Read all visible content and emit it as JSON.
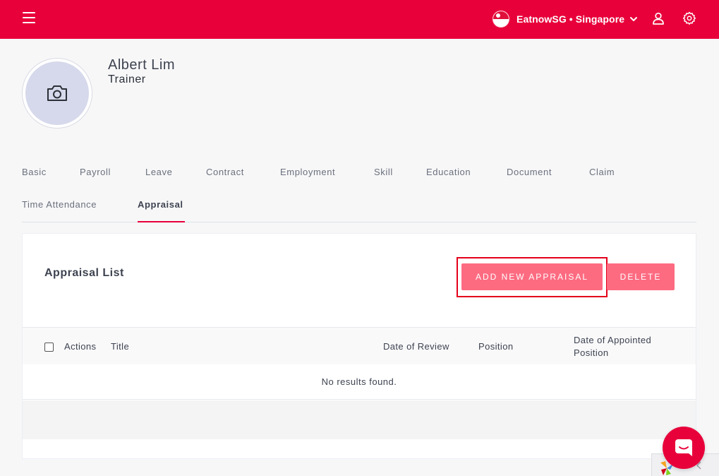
{
  "topbar": {
    "company_label": "EatnowSG • Singapore",
    "brand_color": "#e8003a",
    "icons": [
      "menu-icon",
      "singapore-flag-icon",
      "chevron-down-icon",
      "user-icon",
      "settings-gear-icon"
    ]
  },
  "profile": {
    "name": "Albert Lim",
    "role": "Trainer",
    "avatar_icon": "camera-icon"
  },
  "tabs": [
    {
      "label": "Basic"
    },
    {
      "label": "Payroll"
    },
    {
      "label": "Leave"
    },
    {
      "label": "Contract"
    },
    {
      "label": "Employment"
    },
    {
      "label": "Skill"
    },
    {
      "label": "Education"
    },
    {
      "label": "Document"
    },
    {
      "label": "Claim"
    },
    {
      "label": "Time Attendance"
    },
    {
      "label": "Appraisal",
      "active": true
    }
  ],
  "appraisal": {
    "title": "Appraisal List",
    "add_button": "ADD NEW APPRAISAL",
    "delete_button": "DELETE",
    "button_color": "#fd6b81",
    "columns": [
      "Actions",
      "Title",
      "Date of Review",
      "Position",
      "Date of Appointed Position"
    ],
    "rows": [],
    "empty_message": "No results found."
  },
  "widgets": {
    "chat_icon": "chat-bubble-icon",
    "corner_icons": [
      "pinwheel-logo-icon",
      "chevron-left-icon"
    ]
  }
}
